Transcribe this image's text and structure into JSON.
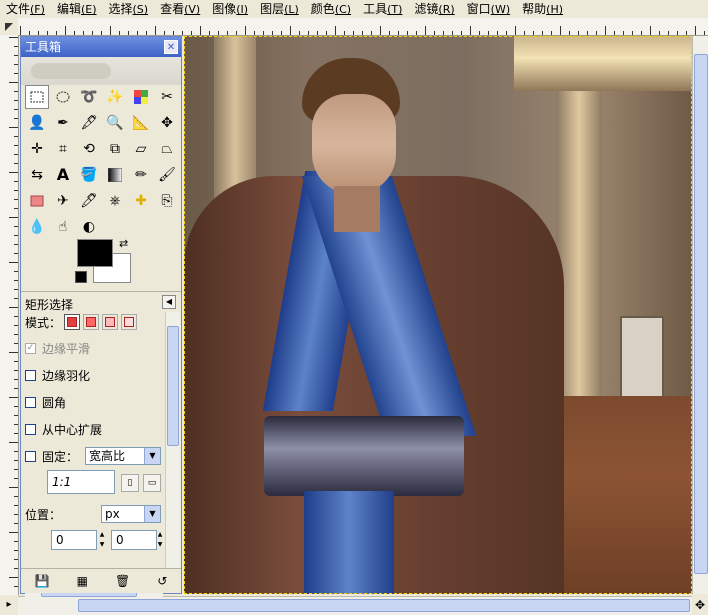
{
  "menus": [
    {
      "label": "文件",
      "mnemonic": "(F)"
    },
    {
      "label": "编辑",
      "mnemonic": "(E)"
    },
    {
      "label": "选择",
      "mnemonic": "(S)"
    },
    {
      "label": "查看",
      "mnemonic": "(V)"
    },
    {
      "label": "图像",
      "mnemonic": "(I)"
    },
    {
      "label": "图层",
      "mnemonic": "(L)"
    },
    {
      "label": "颜色",
      "mnemonic": "(C)"
    },
    {
      "label": "工具",
      "mnemonic": "(T)"
    },
    {
      "label": "滤镜",
      "mnemonic": "(R)"
    },
    {
      "label": "窗口",
      "mnemonic": "(W)"
    },
    {
      "label": "帮助",
      "mnemonic": "(H)"
    }
  ],
  "toolbox": {
    "title": "工具箱",
    "close_icon": "close-icon",
    "tools": [
      "rect-select-icon",
      "ellipse-select-icon",
      "lasso-icon",
      "magic-wand-icon",
      "select-by-color-icon",
      "scissors-icon",
      "foreground-select-icon",
      "paths-icon",
      "color-picker-icon",
      "zoom-icon",
      "measure-icon",
      "move-icon",
      "align-icon",
      "crop-icon",
      "rotate-icon",
      "scale-icon",
      "shear-icon",
      "perspective-icon",
      "flip-icon",
      "text-icon",
      "bucket-fill-icon",
      "blend-icon",
      "pencil-icon",
      "paintbrush-icon",
      "eraser-icon",
      "airbrush-icon",
      "ink-icon",
      "clone-icon",
      "heal-icon",
      "perspective-clone-icon",
      "blur-icon",
      "smudge-icon",
      "dodge-burn-icon"
    ],
    "foreground_color": "#000000",
    "background_color": "#ffffff"
  },
  "tool_options": {
    "title": "矩形选择",
    "mode_label": "模式：",
    "antialias_label": "边缘平滑",
    "feather_label": "边缘羽化",
    "rounded_label": "圆角",
    "expand_center_label": "从中心扩展",
    "fixed_label": "固定：",
    "fixed_mode_value": "宽高比",
    "ratio_value": "1:1",
    "position_label": "位置：",
    "unit_value": "px",
    "pos_x_value": "0",
    "pos_y_value": "0"
  },
  "colors": {
    "accent": "#3d63c8",
    "marching_ants": "#f5d000"
  }
}
